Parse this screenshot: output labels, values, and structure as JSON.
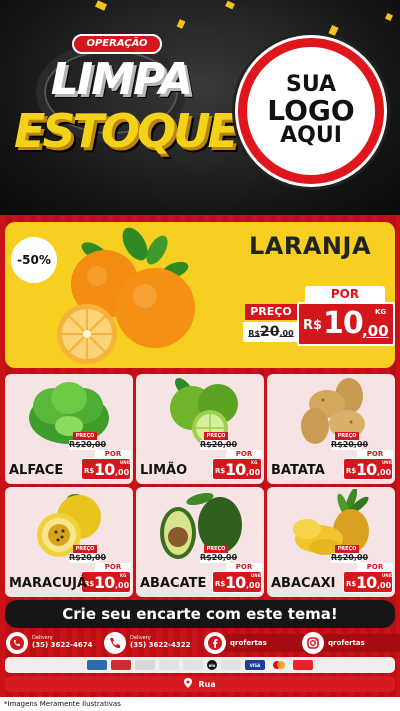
{
  "header": {
    "title_badge": "OPERAÇÃO",
    "title_line1": "LIMPA",
    "title_line2": "ESTOQUE",
    "logo_line1": "SUA",
    "logo_line2": "LOGO",
    "logo_line3": "AQUI"
  },
  "featured": {
    "discount": "-50%",
    "name": "LARANJA",
    "price_label": "PREÇO",
    "old_price": "R$20,00",
    "old_int": "20",
    "old_dec": ",00",
    "old_cur": "R$",
    "por_label": "POR",
    "currency": "R$",
    "price_int": "10",
    "price_dec": ",00",
    "unit": "KG"
  },
  "products": [
    {
      "name": "ALFACE",
      "preco": "PREÇO",
      "old": "R$20,00",
      "por": "POR",
      "currency": "R$",
      "int": "10",
      "dec": ",00",
      "unit": "UNID"
    },
    {
      "name": "LIMÃO",
      "preco": "PREÇO",
      "old": "R$20,00",
      "por": "POR",
      "currency": "R$",
      "int": "10",
      "dec": ",00",
      "unit": "KG"
    },
    {
      "name": "BATATA",
      "preco": "PREÇO",
      "old": "R$20,00",
      "por": "POR",
      "currency": "R$",
      "int": "10",
      "dec": ",00",
      "unit": "UNID"
    },
    {
      "name": "MARACUJÁ",
      "preco": "PREÇO",
      "old": "R$20,00",
      "por": "POR",
      "currency": "R$",
      "int": "10",
      "dec": ",00",
      "unit": "KG"
    },
    {
      "name": "ABACATE",
      "preco": "PREÇO",
      "old": "R$20,00",
      "por": "POR",
      "currency": "R$",
      "int": "10",
      "dec": ",00",
      "unit": "UNID"
    },
    {
      "name": "ABACAXI",
      "preco": "PREÇO",
      "old": "R$20,00",
      "por": "POR",
      "currency": "R$",
      "int": "10",
      "dec": ",00",
      "unit": "UNID"
    }
  ],
  "cta": "Crie seu encarte com este tema!",
  "contacts": {
    "whatsapp_label": "Delivery",
    "whatsapp_number": "(35) 3622-4674",
    "phone_label": "Delivery",
    "phone_number": "(35) 3622-4322",
    "facebook_handle": "qrofertas",
    "instagram_handle": "qrofertas"
  },
  "payment": {
    "visa": "VISA",
    "elo": "elo"
  },
  "address": "Rua",
  "disclaimer": "*Imagens Meramente Ilustrativas",
  "colors": {
    "brand_red": "#d4161d",
    "yellow": "#f6cf20",
    "dark": "#161616"
  }
}
